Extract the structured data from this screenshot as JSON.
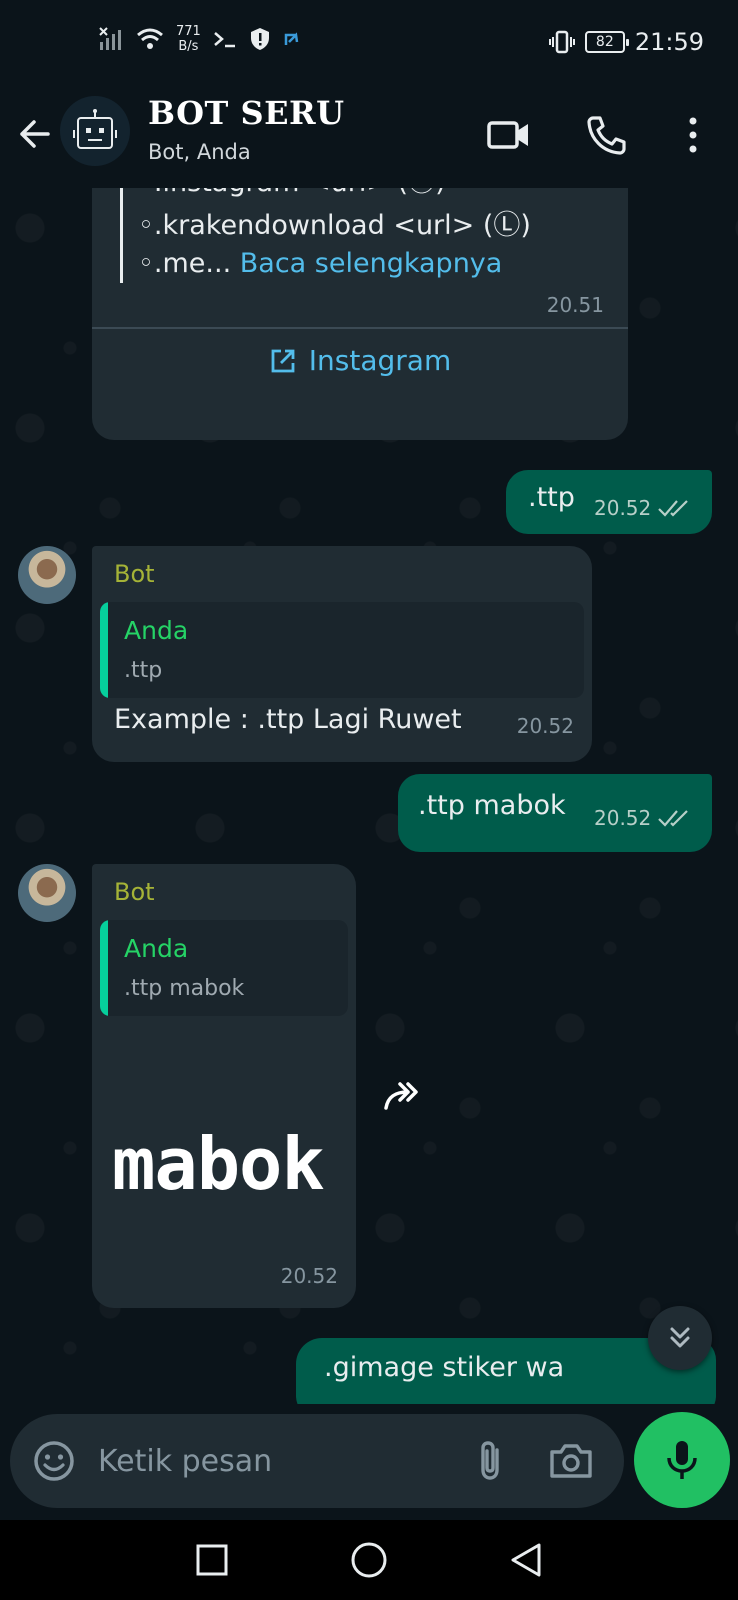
{
  "status_bar": {
    "net_speed_value": "771",
    "net_speed_unit": "B/s",
    "battery": "82",
    "time": "21:59"
  },
  "header": {
    "title": "BOT SERU",
    "subtitle": "Bot, Anda"
  },
  "messages": {
    "m1": {
      "lines": [
        "◦.instagram <url> (Ⓛ)",
        "◦.krakendownload <url> (Ⓛ)"
      ],
      "last_line_prefix": "◦.me...",
      "read_more": "Baca selengkapnya",
      "time": "20.51",
      "button_label": "Instagram"
    },
    "m2": {
      "text": ".ttp",
      "time": "20.52"
    },
    "m3": {
      "sender": "Bot",
      "quote_name": "Anda",
      "quote_text": ".ttp",
      "text": "Example : .ttp Lagi Ruwet",
      "time": "20.52"
    },
    "m4": {
      "text": ".ttp mabok",
      "time": "20.52"
    },
    "m5": {
      "sender": "Bot",
      "quote_name": "Anda",
      "quote_text": ".ttp mabok",
      "sticker_text": "mabok",
      "time": "20.52"
    },
    "m6": {
      "text": ".gimage stiker wa"
    }
  },
  "composer": {
    "placeholder": "Ketik pesan"
  },
  "colors": {
    "background": "#0b141a",
    "incoming_bubble": "#202c33",
    "outgoing_bubble": "#005c4b",
    "accent_green": "#21c063",
    "link_blue": "#53bdeb",
    "sender_name": "#a5b337"
  }
}
